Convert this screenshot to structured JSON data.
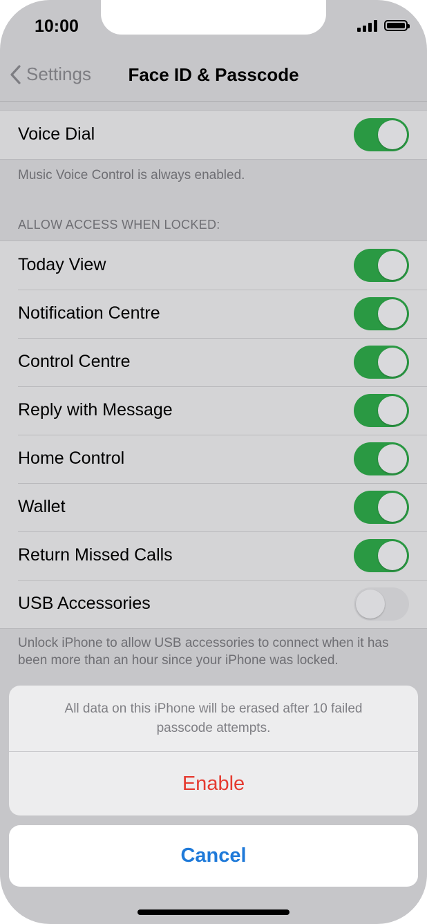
{
  "status_bar": {
    "time": "10:00"
  },
  "nav": {
    "back_label": "Settings",
    "title": "Face ID & Passcode"
  },
  "voice_dial": {
    "label": "Voice Dial",
    "on": true,
    "footer": "Music Voice Control is always enabled."
  },
  "lock_access": {
    "header": "ALLOW ACCESS WHEN LOCKED:",
    "items": [
      {
        "label": "Today View",
        "on": true
      },
      {
        "label": "Notification Centre",
        "on": true
      },
      {
        "label": "Control Centre",
        "on": true
      },
      {
        "label": "Reply with Message",
        "on": true
      },
      {
        "label": "Home Control",
        "on": true
      },
      {
        "label": "Wallet",
        "on": true
      },
      {
        "label": "Return Missed Calls",
        "on": true
      },
      {
        "label": "USB Accessories",
        "on": false
      }
    ],
    "footer": "Unlock iPhone to allow USB accessories to connect when it has been more than an hour since your iPhone was locked."
  },
  "action_sheet": {
    "message": "All data on this iPhone will be erased after 10 failed passcode attempts.",
    "enable_label": "Enable",
    "cancel_label": "Cancel"
  },
  "colors": {
    "toggle_on": "#2a9943",
    "destructive": "#e53b30",
    "accent": "#1f7ad9"
  }
}
